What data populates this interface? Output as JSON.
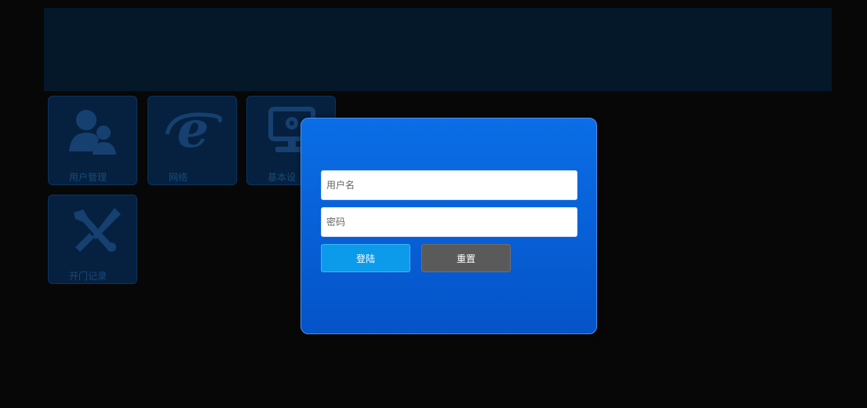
{
  "tiles": [
    {
      "label": "用户管理",
      "icon": "users-icon"
    },
    {
      "label": "网络",
      "icon": "internet-explorer-icon"
    },
    {
      "label": "基本设",
      "icon": "monitor-settings-icon"
    },
    {
      "label": "开门记录",
      "icon": "tools-icon"
    }
  ],
  "login": {
    "username_placeholder": "用户名",
    "password_placeholder": "密码",
    "login_label": "登陆",
    "reset_label": "重置"
  },
  "colors": {
    "background": "#070707",
    "banner": "#04182a",
    "tile": "#05213f",
    "tile_icon": "#164070",
    "dialog": "#0b6ee6",
    "login_button": "#0c9bea",
    "reset_button": "#5a5a5a"
  }
}
